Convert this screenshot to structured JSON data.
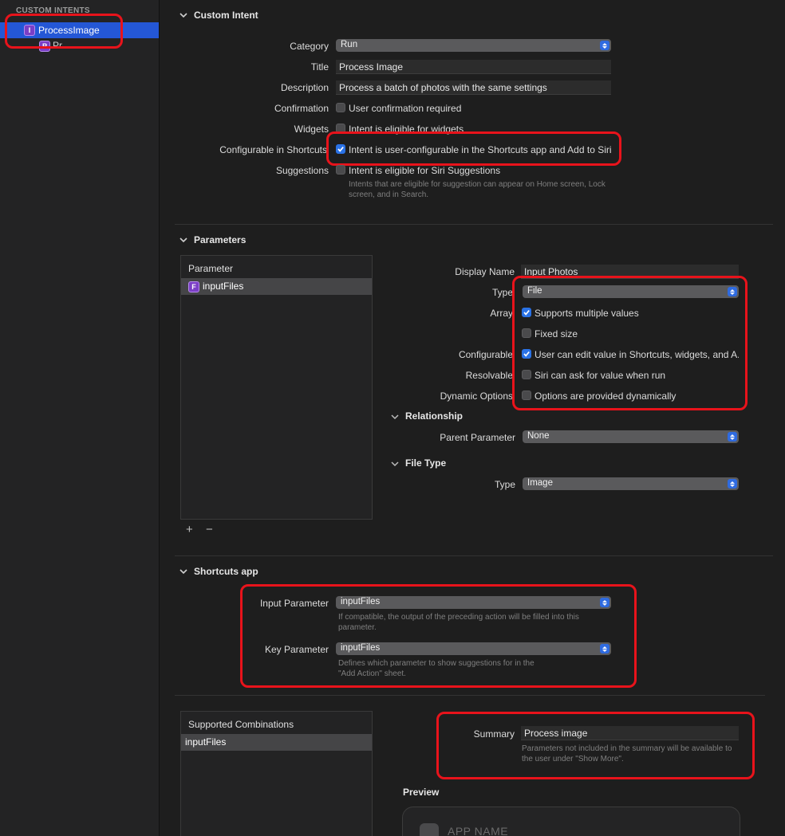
{
  "sidebar": {
    "header": "CUSTOM INTENTS",
    "selected_item": {
      "label": "ProcessImage",
      "badge": "I"
    },
    "sub_item": {
      "label": "Pr...",
      "badge": "P"
    }
  },
  "custom_intent": {
    "section_title": "Custom Intent",
    "category": {
      "label": "Category",
      "value": "Run"
    },
    "title": {
      "label": "Title",
      "value": "Process Image"
    },
    "description": {
      "label": "Description",
      "value": "Process a batch of photos with the same settings"
    },
    "confirmation": {
      "label": "Confirmation",
      "text": "User confirmation required",
      "checked": false
    },
    "widgets": {
      "label": "Widgets",
      "text": "Intent is eligible for widgets",
      "checked": false
    },
    "configurable": {
      "label": "Configurable in Shortcuts",
      "text": "Intent is user-configurable in the Shortcuts app and Add to Siri",
      "checked": true
    },
    "suggestions": {
      "label": "Suggestions",
      "text": "Intent is eligible for Siri Suggestions",
      "checked": false,
      "hint": "Intents that are eligible for suggestion can appear on Home screen, Lock screen, and in Search."
    }
  },
  "parameters": {
    "section_title": "Parameters",
    "list_header": "Parameter",
    "items": [
      {
        "label": "inputFiles",
        "badge": "F"
      }
    ],
    "add_label": "+",
    "remove_label": "−",
    "display_name": {
      "label": "Display Name",
      "value": "Input Photos"
    },
    "type": {
      "label": "Type",
      "value": "File"
    },
    "array": {
      "label": "Array",
      "text": "Supports multiple values",
      "checked": true
    },
    "fixed_size": {
      "text": "Fixed size",
      "checked": false
    },
    "configurable": {
      "label": "Configurable",
      "text": "User can edit value in Shortcuts, widgets, and A...",
      "checked": true
    },
    "resolvable": {
      "label": "Resolvable",
      "text": "Siri can ask for value when run",
      "checked": false
    },
    "dynamic_options": {
      "label": "Dynamic Options",
      "text": "Options are provided dynamically",
      "checked": false
    },
    "relationship": {
      "title": "Relationship",
      "parent_label": "Parent Parameter",
      "parent_value": "None"
    },
    "file_type": {
      "title": "File Type",
      "type_label": "Type",
      "type_value": "Image"
    }
  },
  "shortcuts_app": {
    "section_title": "Shortcuts app",
    "input_parameter": {
      "label": "Input Parameter",
      "value": "inputFiles",
      "hint": "If compatible, the output of the preceding action will be filled into this parameter."
    },
    "key_parameter": {
      "label": "Key Parameter",
      "value": "inputFiles",
      "hint": "Defines which parameter to show suggestions for in the \"Add Action\" sheet."
    }
  },
  "combinations": {
    "list_header": "Supported Combinations",
    "items": [
      "inputFiles"
    ],
    "summary": {
      "label": "Summary",
      "value": "Process image",
      "hint": "Parameters not included in the summary will be available to the user under \"Show More\"."
    },
    "preview_title": "Preview",
    "preview_app_name": "APP NAME"
  },
  "colors": {
    "accent": "#2a72e6",
    "highlight_annotation": "#e8131b",
    "selection": "#2457d6",
    "badge": "#7b3fc6"
  }
}
